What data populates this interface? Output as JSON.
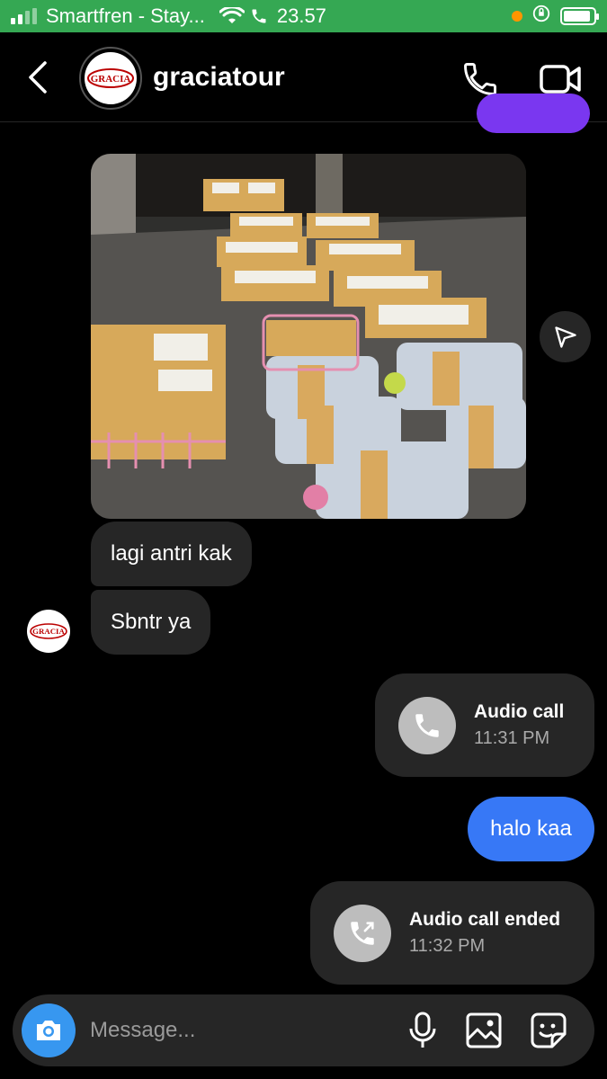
{
  "status_bar": {
    "carrier": "Smartfren - Stay...",
    "time": "23.57",
    "battery_level": 0.9
  },
  "header": {
    "username": "graciatour",
    "logo_text": "GRACIA",
    "icons": [
      "back-icon",
      "phone-icon",
      "video-icon"
    ]
  },
  "messages": {
    "incoming_1": "lagi antri kak",
    "incoming_2": "Sbntr ya",
    "call_1": {
      "title": "Audio call",
      "time": "11:31 PM"
    },
    "outgoing_1": "halo kaa",
    "call_2": {
      "title": "Audio call ended",
      "time": "11:32 PM"
    }
  },
  "composer": {
    "placeholder": "Message..."
  },
  "colors": {
    "status_bar": "#35a853",
    "outgoing_bubble": "#3778f6",
    "incoming_bubble": "#262626",
    "camera_button": "#3797f0",
    "purple_bubble": "#7a37f0"
  }
}
